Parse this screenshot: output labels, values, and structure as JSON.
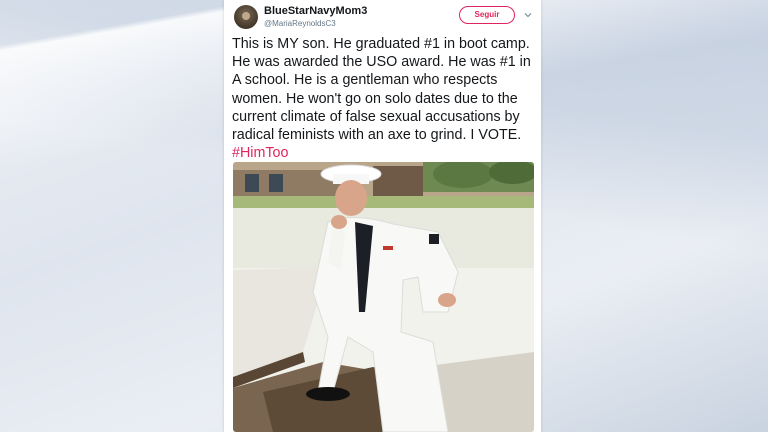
{
  "tweet": {
    "display_name": "BlueStarNavyMom3",
    "handle": "@MariaReynoldsC3",
    "follow_label": "Seguir",
    "text_main": "This is MY son. He graduated #1 in boot camp. He was awarded the USO award. He was #1 in A school. He is a gentleman who respects women. He won't go on solo dates due to the current climate of false sexual accusations by radical feminists with an axe to grind. I VOTE. ",
    "hashtag": "#HimToo",
    "accent_color": "#e0245e",
    "icons": {
      "more": "chevron-down-icon"
    }
  }
}
